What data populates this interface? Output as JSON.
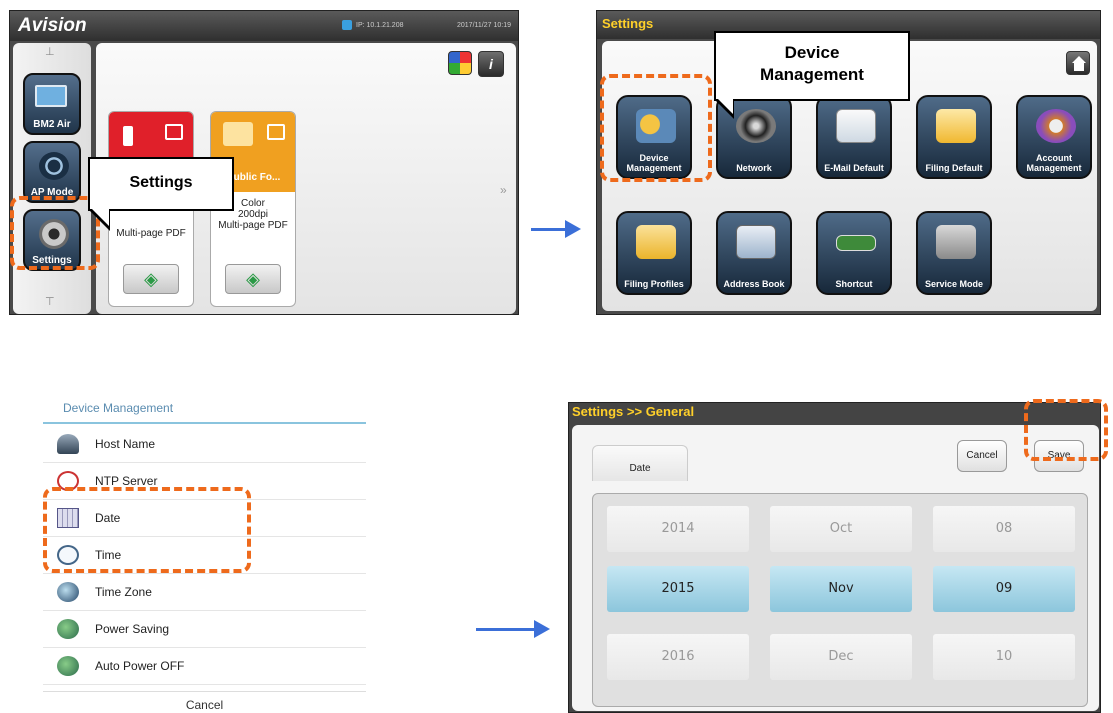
{
  "panel1": {
    "brand": "Avision",
    "ip": "IP: 10.1.21.208",
    "timestamp": "2017/11/27 10:19",
    "sidebar": [
      {
        "label": "BM2 Air",
        "icon": "computer-icon"
      },
      {
        "label": "AP Mode",
        "icon": "wifi-icon"
      },
      {
        "label": "Settings",
        "icon": "gear-icon"
      }
    ],
    "cards": [
      {
        "title": "",
        "text": "Multi-page PDF",
        "color": "#e0202a"
      },
      {
        "title": "Public Fo...",
        "text": "Color\n200dpi\nMulti-page PDF",
        "color": "#f0a020"
      }
    ],
    "more_glyph": "»",
    "callout": "Settings"
  },
  "panel2": {
    "title": "Settings",
    "callout": "Device\nManagement",
    "tiles": [
      {
        "label": "Device\nManagement",
        "icon": "device-management-icon"
      },
      {
        "label": "Network",
        "icon": "network-icon"
      },
      {
        "label": "E-Mail Default",
        "icon": "email-icon"
      },
      {
        "label": "Filing Default",
        "icon": "folder-icon"
      },
      {
        "label": "Account\nManagement",
        "icon": "account-icon"
      },
      {
        "label": "Filing Profiles",
        "icon": "filing-profiles-icon"
      },
      {
        "label": "Address Book",
        "icon": "address-book-icon"
      },
      {
        "label": "Shortcut",
        "icon": "shortcut-icon"
      },
      {
        "label": "Service Mode",
        "icon": "service-mode-icon"
      }
    ]
  },
  "panel3": {
    "header": "Device Management",
    "items": [
      {
        "label": "Host Name",
        "icon": "host-icon"
      },
      {
        "label": "NTP Server",
        "icon": "ntp-icon"
      },
      {
        "label": "Date",
        "icon": "calendar-icon"
      },
      {
        "label": "Time",
        "icon": "clock-icon"
      },
      {
        "label": "Time Zone",
        "icon": "globe-icon"
      },
      {
        "label": "Power Saving",
        "icon": "power-saving-icon"
      },
      {
        "label": "Auto Power OFF",
        "icon": "power-off-icon"
      }
    ],
    "cancel": "Cancel"
  },
  "panel4": {
    "title": "Settings >> General",
    "tab": "Date",
    "cancel": "Cancel",
    "save": "Save",
    "years": [
      "2014",
      "2015",
      "2016"
    ],
    "months": [
      "Oct",
      "Nov",
      "Dec"
    ],
    "days": [
      "08",
      "09",
      "10"
    ]
  },
  "colors": {
    "accent": "#ee6a1c",
    "arrow": "#3b6fd8",
    "title_yellow": "#ffd02a"
  }
}
